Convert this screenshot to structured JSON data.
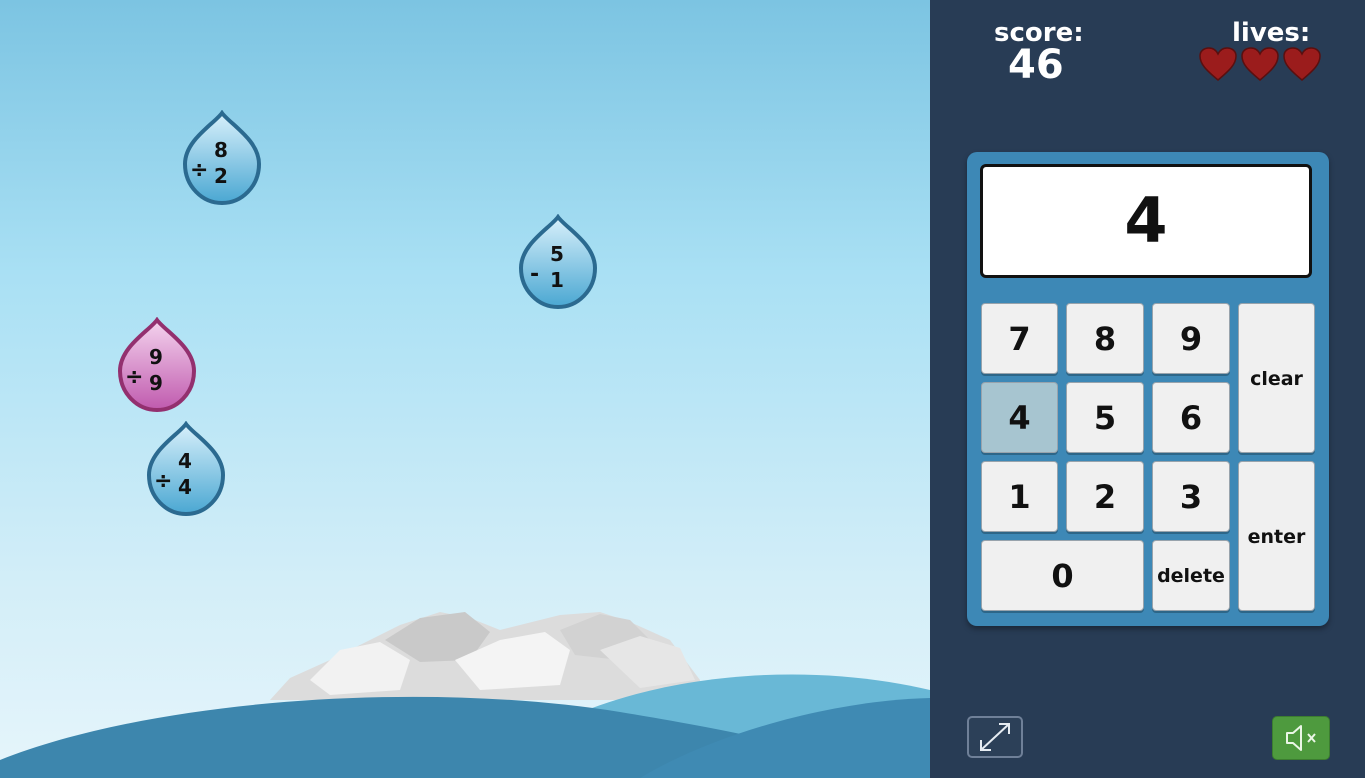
{
  "hud": {
    "score_label": "score:",
    "score_value": "46",
    "lives_label": "lives:",
    "lives_count": 3,
    "heart_color": "#9b1c1c"
  },
  "calculator": {
    "display_value": "4",
    "keys": {
      "k7": "7",
      "k8": "8",
      "k9": "9",
      "clear": "clear",
      "k4": "4",
      "k5": "5",
      "k6": "6",
      "k1": "1",
      "k2": "2",
      "k3": "3",
      "enter": "enter",
      "k0": "0",
      "delete": "delete"
    },
    "active_key": "4"
  },
  "drops": [
    {
      "operator": "÷",
      "top": "8",
      "bottom": "2",
      "color": "blue"
    },
    {
      "operator": "-",
      "top": "5",
      "bottom": "1",
      "color": "blue"
    },
    {
      "operator": "÷",
      "top": "9",
      "bottom": "9",
      "color": "pink"
    },
    {
      "operator": "÷",
      "top": "4",
      "bottom": "4",
      "color": "blue"
    }
  ],
  "controls": {
    "fullscreen_icon": "expand-arrows-icon",
    "sound_icon": "speaker-muted-icon"
  },
  "colors": {
    "panel_bg": "#283c55",
    "calculator_bg": "#3d88b6",
    "drop_blue": "#5fb5da",
    "drop_pink": "#c65eb4",
    "sound_button": "#4e9a3e"
  }
}
